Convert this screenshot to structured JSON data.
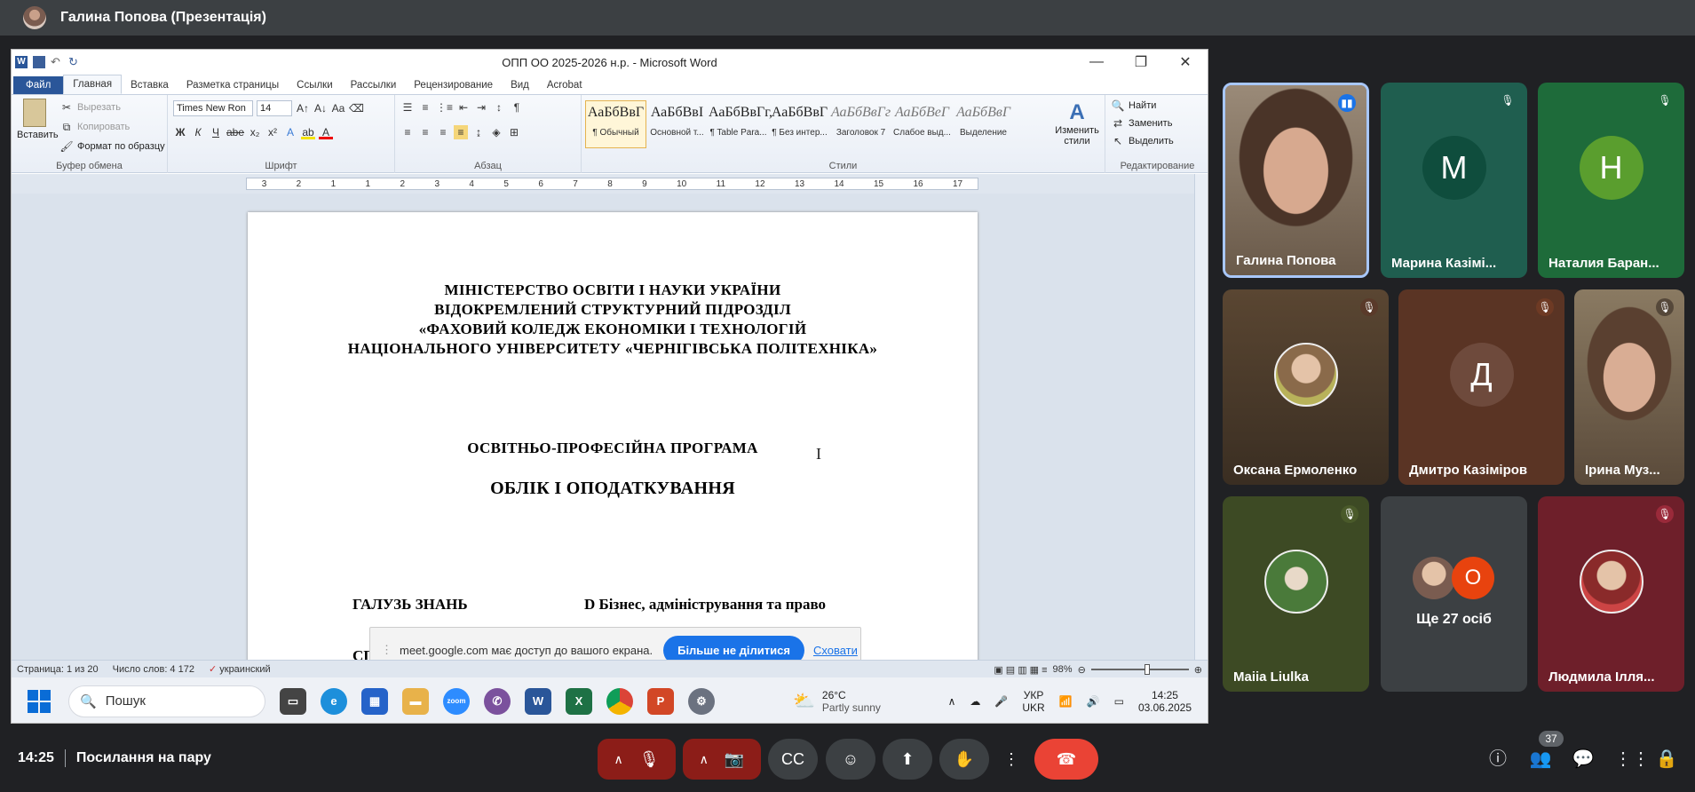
{
  "presenter_bar": {
    "label": "Галина Попова (Презентація)"
  },
  "word": {
    "title": "ОПП ОО 2025-2026 н.р.  -  Microsoft Word",
    "tabs": [
      "Файл",
      "Главная",
      "Вставка",
      "Разметка страницы",
      "Ссылки",
      "Рассылки",
      "Рецензирование",
      "Вид",
      "Acrobat"
    ],
    "ribbon": {
      "clipboard": {
        "paste": "Вставить",
        "cut": "Вырезать",
        "copy": "Копировать",
        "format": "Формат по образцу",
        "label": "Буфер обмена"
      },
      "font": {
        "name": "Times New Ron",
        "size": "14",
        "label": "Шрифт"
      },
      "paragraph": {
        "label": "Абзац"
      },
      "styles": {
        "items": [
          {
            "preview": "АаБбВвГ",
            "name": "¶ Обычный"
          },
          {
            "preview": "АаБбВвІ",
            "name": "Основной т..."
          },
          {
            "preview": "АаБбВвГг,",
            "name": "¶ Table Para..."
          },
          {
            "preview": "АаБбВвГ",
            "name": "¶ Без интер..."
          },
          {
            "preview": "АаБбВвГг",
            "name": "Заголовок 7"
          },
          {
            "preview": "АаБбВеГ",
            "name": "Слабое выд..."
          },
          {
            "preview": "АаБбВвГ",
            "name": "Выделение"
          }
        ],
        "change": "Изменить стили",
        "label": "Стили"
      },
      "editing": {
        "find": "Найти",
        "replace": "Заменить",
        "select": "Выделить",
        "label": "Редактирование"
      }
    },
    "ruler": [
      "3",
      "2",
      "1",
      "1",
      "2",
      "3",
      "4",
      "5",
      "6",
      "7",
      "8",
      "9",
      "10",
      "11",
      "12",
      "13",
      "14",
      "15",
      "16",
      "17"
    ],
    "document": {
      "header_lines": [
        "МІНІСТЕРСТВО ОСВІТИ І НАУКИ УКРАЇНИ",
        "ВІДОКРЕМЛЕНИЙ СТРУКТУРНИЙ ПІДРОЗДІЛ",
        "«ФАХОВИЙ КОЛЕДЖ ЕКОНОМІКИ І ТЕХНОЛОГІЙ",
        "НАЦІОНАЛЬНОГО УНІВЕРСИТЕТУ «ЧЕРНІГІВСЬКА ПОЛІТЕХНІКА»"
      ],
      "program_type": "ОСВІТНЬО-ПРОФЕСІЙНА ПРОГРАМА",
      "program_name": "ОБЛІК І ОПОДАТКУВАННЯ",
      "field_label": "ГАЛУЗЬ ЗНАНЬ",
      "field_value": "D Бізнес, адміністрування та право",
      "next_line_fragment": "СП"
    },
    "status": {
      "page": "Страница: 1 из 20",
      "words": "Число слов: 4 172",
      "language": "украинский",
      "zoom": "98%"
    }
  },
  "share_notice": {
    "text": "meet.google.com має доступ до вашого екрана.",
    "stop_button": "Більше не ділитися",
    "hide_link": "Сховати"
  },
  "taskbar": {
    "search_placeholder": "Пошук",
    "weather_temp": "26°C",
    "weather_desc": "Partly sunny",
    "lang_top": "УКР",
    "lang_bottom": "UKR",
    "time": "14:25",
    "date": "03.06.2025"
  },
  "participants": [
    {
      "name": "Галина Попова",
      "type": "video",
      "speaking": true
    },
    {
      "name": "Марина Казімі...",
      "initial": "М",
      "bg": "#1f5e4f",
      "circle": "#0f4d3d",
      "muted": true
    },
    {
      "name": "Наталия Баран...",
      "initial": "Н",
      "bg": "#1e6b3a",
      "circle": "#5a9e2e",
      "muted": true
    },
    {
      "name": "Оксана Ермоленко",
      "type": "photo",
      "bg": "#4a3a2a",
      "muted": true
    },
    {
      "name": "Дмитро Казіміров",
      "initial": "Д",
      "bg": "#5a3424",
      "circle": "#6e4a3c",
      "muted": true
    },
    {
      "name": "Ірина Муз...",
      "type": "video",
      "bg": "#7a6a55",
      "muted": true
    },
    {
      "name": "Maiia Liulka",
      "type": "photo",
      "bg": "#3d4a24",
      "muted": true
    },
    {
      "name": "Людмила Ілля...",
      "type": "photo",
      "bg": "#6e1f2a",
      "muted": true
    }
  ],
  "others": {
    "label": "Ще 27 осіб",
    "badge": "О"
  },
  "meeting": {
    "time": "14:25",
    "name": "Посилання на пару",
    "people_count": "37"
  },
  "colors": {
    "meet_bg": "#202124",
    "word_blue": "#2a5699",
    "end_call": "#ea4335",
    "mute_red": "#8c1d18"
  }
}
